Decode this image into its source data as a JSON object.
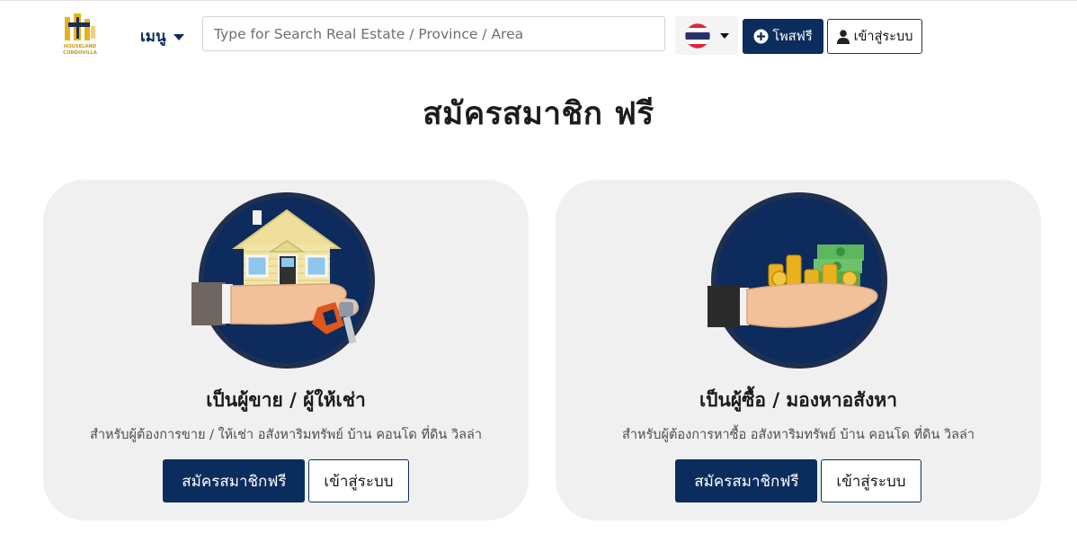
{
  "header": {
    "logo_text": [
      "HOUSELAND",
      "CONDOVILLA"
    ],
    "menu_label": "เมนู",
    "search_placeholder": "Type for Search Real Estate / Province / Area",
    "language_flag": "thailand-flag-icon",
    "post_label": "โพสฟรี",
    "login_label": "เข้าสู่ระบบ"
  },
  "page_title": "สมัครสมาชิก ฟรี",
  "cards": [
    {
      "title": "เป็นผู้ขาย / ผู้ให้เช่า",
      "description": "สำหรับผู้ต้องการขาย / ให้เช่า อสังหาริมทรัพย์ บ้าน คอนโด ที่ดิน วิลล่า",
      "register_label": "สมัครสมาชิกฟรี",
      "login_label": "เข้าสู่ระบบ",
      "illustration": "house-in-hand-with-keys-icon"
    },
    {
      "title": "เป็นผู้ซื้อ / มองหาอสังหา",
      "description": "สำหรับผู้ต้องการหาซื้อ อสังหาริมทรัพย์ บ้าน คอนโด ที่ดิน วิลล่า",
      "register_label": "สมัครสมาชิกฟรี",
      "login_label": "เข้าสู่ระบบ",
      "illustration": "money-in-hand-icon"
    }
  ],
  "colors": {
    "primary": "#0b2d5e",
    "card_bg": "#f0f0f0",
    "logo_gold": "#e8b21e"
  }
}
